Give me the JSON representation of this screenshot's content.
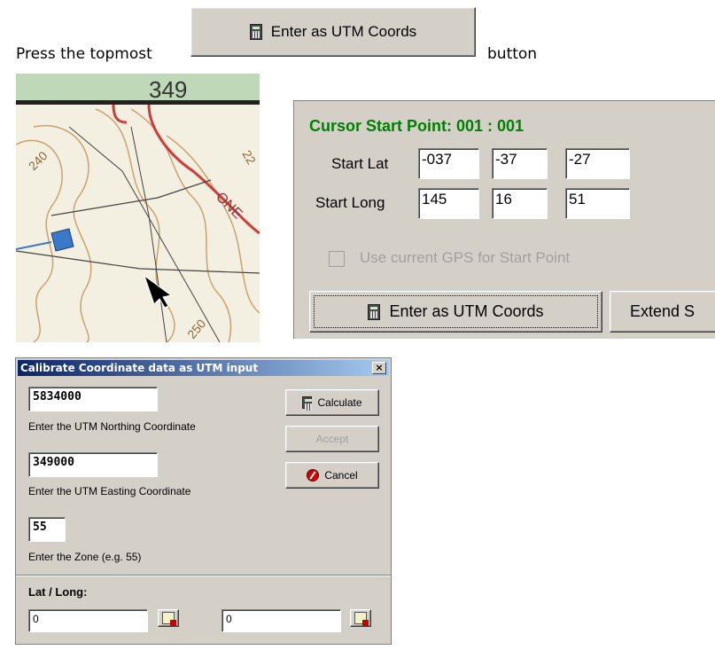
{
  "instruction": {
    "prefix": "Press the topmost",
    "suffix": "button",
    "button_label": "Enter as UTM Coords"
  },
  "map": {
    "grid_label": "349",
    "contour_labels": [
      "240",
      "22",
      "ONE",
      "250"
    ]
  },
  "start_panel": {
    "title": "Cursor Start Point: 001 : 001",
    "start_lat_label": "Start Lat",
    "start_lat_values": [
      "-037",
      "-37",
      "-27"
    ],
    "start_long_label": "Start Long",
    "start_long_values": [
      "145",
      "16",
      "51"
    ],
    "gps_checkbox_label": "Use current GPS for Start Point",
    "enter_utm_label": "Enter as UTM Coords",
    "extend_label": "Extend S"
  },
  "dialog": {
    "title": "Calibrate Coordinate data as UTM input",
    "close": "×",
    "northing_value": "5834000",
    "northing_label": "Enter the UTM Northing Coordinate",
    "easting_value": "349000",
    "easting_label": "Enter the UTM Easting Coordinate",
    "zone_value": "55",
    "zone_label": "Enter the Zone (e.g. 55)",
    "calculate_label": "Calculate",
    "accept_label": "Accept",
    "cancel_label": "Cancel",
    "latlong_label": "Lat / Long:",
    "lat_value": "0",
    "long_value": "0"
  },
  "colors": {
    "panel_title": "#008000",
    "dialog_bg": "#d4d0c8",
    "titlebar_start": "#0a246a"
  }
}
